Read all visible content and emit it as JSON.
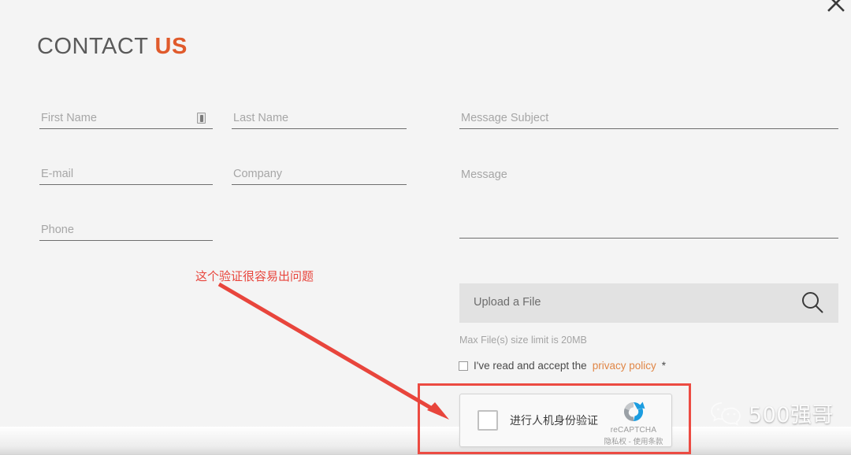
{
  "window": {
    "close_icon": "close-icon"
  },
  "heading": {
    "lead": "CONTACT ",
    "accent": "US"
  },
  "form": {
    "fields": [
      {
        "name": "first-name",
        "placeholder": "First Name",
        "value": ""
      },
      {
        "name": "last-name",
        "placeholder": "Last Name",
        "value": ""
      },
      {
        "name": "email",
        "placeholder": "E-mail",
        "value": ""
      },
      {
        "name": "company",
        "placeholder": "Company",
        "value": ""
      },
      {
        "name": "phone",
        "placeholder": "Phone",
        "value": ""
      },
      {
        "name": "message-subject",
        "placeholder": "Message Subject",
        "value": ""
      },
      {
        "name": "message",
        "placeholder": "Message",
        "value": ""
      }
    ],
    "autofill_icon": "autofill-icon",
    "upload": {
      "label": "Upload a File",
      "icon": "search-icon",
      "hint": "Max File(s) size limit is 20MB"
    },
    "privacy": {
      "text_before": "I've read and accept the ",
      "link": "privacy policy",
      "required_mark": " *",
      "checked": false
    }
  },
  "recaptcha": {
    "label": "进行人机身份验证",
    "brand": "reCAPTCHA",
    "terms": "隐私权 - 使用条款",
    "checked": false,
    "logo_icon": "recaptcha-logo-icon"
  },
  "annotations": {
    "note": "这个验证很容易出问题",
    "highlight_color": "#ec4b42",
    "arrow_color": "#e8453c"
  },
  "watermark": {
    "text": "500强哥",
    "icon": "wechat-icon"
  },
  "colors": {
    "background": "#f4f4f4",
    "accent_orange": "#e05a2b",
    "link_orange": "#e08646",
    "field_underline": "#6e6e6e",
    "placeholder": "#a6a6a6",
    "upload_bg": "#e2e2e2"
  }
}
